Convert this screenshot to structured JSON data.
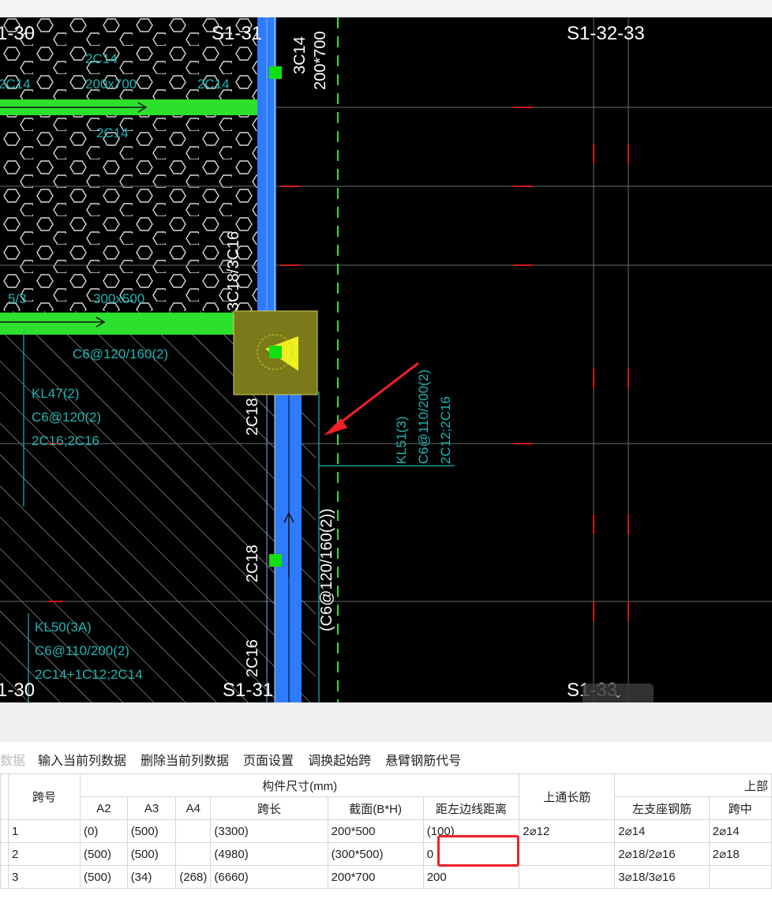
{
  "cad": {
    "axis_labels": {
      "top_left": "1-30",
      "top_mid": "S1-31",
      "top_right": "S1-32-33",
      "bottom_left": "1-30",
      "bottom_mid": "S1-31",
      "bottom_right": "S1-33"
    },
    "annotations": {
      "top_beam_1": "2C14",
      "top_beam_2": "200x700",
      "top_beam_3": "2C14",
      "top_beam_4": "2C14",
      "top_beam_5": "2C14",
      "vertical_a": "3C14",
      "vertical_b": "200*700",
      "vertical_c": "3C18/3C16",
      "beam_mid_size": "300x500",
      "beam_mid_left": "5/3",
      "beam_mid_stirrup": "C6@120/160(2)",
      "kl47_name": "KL47(2)",
      "kl47_stirrup": "C6@120(2)",
      "kl47_bars": "2C16;2C16",
      "col_bar_1": "2C18",
      "col_bar_2": "2C18",
      "col_bar_3": "2C16",
      "kl51_name": "KL51(3)",
      "kl51_stirrup": "C6@110/200(2)",
      "kl51_bars": "2C12;2C16",
      "long_stirrup": "(C6@120/160(2))",
      "kl50_name": "KL50(3A)",
      "kl50_stirrup": "C6@110/200(2)",
      "kl50_bars": "2C14+1C12;2C14"
    },
    "scroll_tab_icon": "chevron-down-icon"
  },
  "toolbar": {
    "partial": "数据",
    "items": [
      "输入当前列数据",
      "删除当前列数据",
      "页面设置",
      "调换起始跨",
      "悬臂钢筋代号"
    ]
  },
  "grid": {
    "headers": {
      "span_no": "跨号",
      "member_size": "构件尺寸(mm)",
      "a2": "A2",
      "a3": "A3",
      "a4": "A4",
      "span_length": "跨长",
      "section": "截面(B*H)",
      "left_edge_dist": "距左边线距离",
      "top_through": "上通长筋",
      "upper_group": "上部",
      "left_support": "左支座钢筋",
      "mid_span": "跨中"
    },
    "rows": [
      {
        "no": "1",
        "a2": "(0)",
        "a3": "(500)",
        "a4": "",
        "len": "(3300)",
        "sec": "200*500",
        "dist": "(100)",
        "top": "2⌀12",
        "left": "2⌀14",
        "mid": "2⌀14"
      },
      {
        "no": "2",
        "a2": "(500)",
        "a3": "(500)",
        "a4": "",
        "len": "(4980)",
        "sec": "(300*500)",
        "dist": "0",
        "top": "",
        "left": "2⌀18/2⌀16",
        "mid": "2⌀18"
      },
      {
        "no": "3",
        "a2": "(500)",
        "a3": "(34)",
        "a4": "(268)",
        "len": "(6660)",
        "sec": "200*700",
        "dist": "200",
        "top": "",
        "left": "3⌀18/3⌀16",
        "mid": ""
      }
    ]
  },
  "colors": {
    "canvas": "#000000",
    "beam_green": "#2ee02e",
    "column_blue": "#2f7bff",
    "annotation_cyan": "#1fb3b3",
    "highlight_red": "#f0202a"
  }
}
